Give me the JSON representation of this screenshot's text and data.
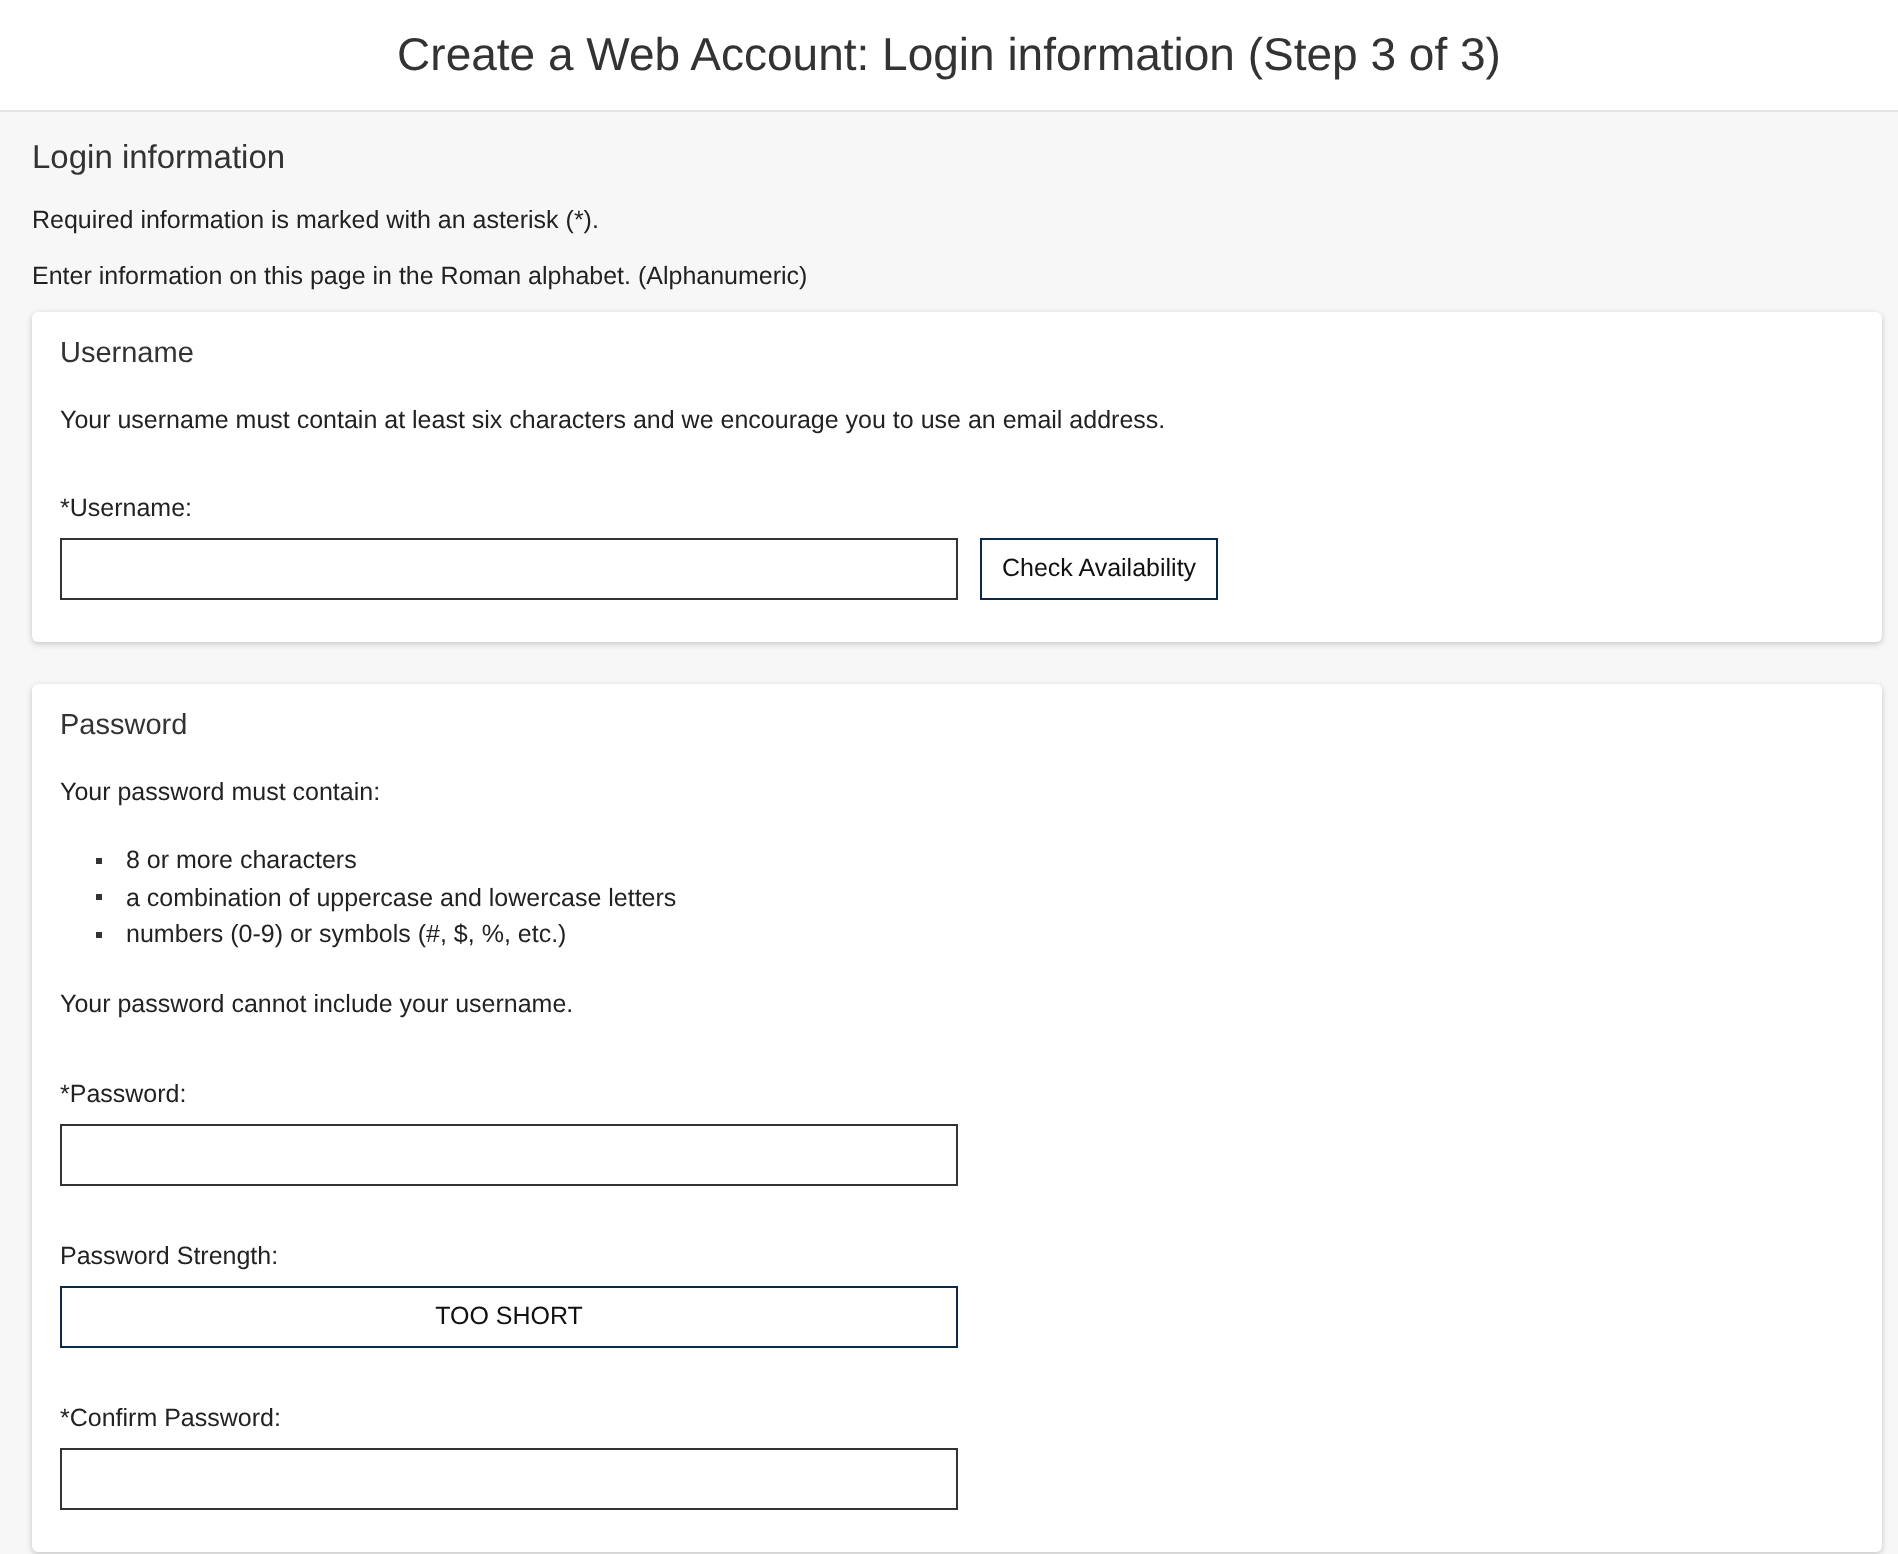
{
  "header": {
    "title": "Create a Web Account: Login information (Step 3 of 3)"
  },
  "section": {
    "title": "Login information",
    "notes": [
      "Required information is marked with an asterisk (*).",
      "Enter information on this page in the Roman alphabet. (Alphanumeric)"
    ]
  },
  "username_card": {
    "title": "Username",
    "description": "Your username must contain at least six characters and we encourage you to use an email address.",
    "field_label": "*Username:",
    "button": "Check Availability"
  },
  "password_card": {
    "title": "Password",
    "intro": "Your password must contain:",
    "rules": [
      "8 or more characters",
      "a combination of uppercase and lowercase letters",
      "numbers (0-9) or symbols (#, $, %, etc.)"
    ],
    "note": "Your password cannot include your username.",
    "fields": [
      {
        "kind": "input",
        "label": "*Password:"
      },
      {
        "kind": "meter",
        "label": "Password Strength:",
        "value": "TOO SHORT"
      },
      {
        "kind": "input",
        "label": "*Confirm Password:"
      }
    ]
  }
}
